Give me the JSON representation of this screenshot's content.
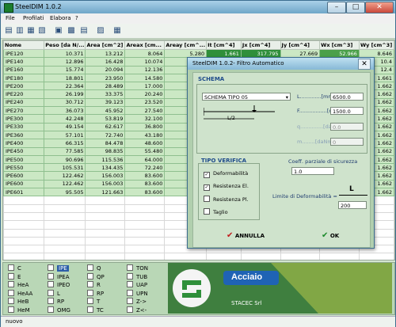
{
  "app": {
    "title": "SteelDIM 1.0.2"
  },
  "window_controls": {
    "minimize": "–",
    "maximize": "□",
    "close": "✕"
  },
  "menu": {
    "items": [
      "File",
      "Profilati",
      "Elabora",
      "?"
    ]
  },
  "toolbar": {
    "icons": [
      "new-icon",
      "open-icon",
      "save-icon",
      "print-icon",
      "table-icon",
      "grid-icon",
      "document-icon",
      "export-icon",
      "settings-icon"
    ]
  },
  "table": {
    "columns": [
      "Nome",
      "Peso [da N/...",
      "Area [cm^2]",
      "Areax [cm...",
      "Areay [cm^...",
      "It [cm^4]",
      "Jx [cm^4]",
      "Jy [cm^4]",
      "Wx [cm^3]",
      "Wy [cm^3]"
    ],
    "rows": [
      [
        "IPE120",
        "10.371",
        "13.212",
        "8.064",
        "5.280",
        "1.661",
        "317.795",
        "27.669",
        "52.966",
        "8.646"
      ],
      [
        "IPE140",
        "12.896",
        "16.428",
        "10.074",
        "6.",
        "",
        "",
        "",
        "",
        "10.4"
      ],
      [
        "IPE160",
        "15.774",
        "20.094",
        "12.136",
        "8.",
        "",
        "",
        "",
        "",
        "12.4"
      ],
      [
        "IPE180",
        "18.801",
        "23.950",
        "14.580",
        "9.",
        "",
        "",
        "",
        "",
        "1.661"
      ],
      [
        "IPE200",
        "22.364",
        "28.489",
        "17.000",
        "11.",
        "",
        "",
        "",
        "",
        "1.662"
      ],
      [
        "IPE220",
        "26.199",
        "33.375",
        "20.240",
        "12.",
        "",
        "",
        "",
        "",
        "1.662"
      ],
      [
        "IPE240",
        "30.712",
        "39.123",
        "23.520",
        "14.",
        "",
        "",
        "",
        "",
        "1.662"
      ],
      [
        "IPE270",
        "36.073",
        "45.952",
        "27.540",
        "17.",
        "",
        "",
        "",
        "",
        "1.662"
      ],
      [
        "IPE300",
        "42.248",
        "53.819",
        "32.100",
        "21.",
        "",
        "",
        "",
        "",
        "1.662"
      ],
      [
        "IPE330",
        "49.154",
        "62.617",
        "36.800",
        "24.",
        "",
        "",
        "",
        "",
        "1.662"
      ],
      [
        "IPE360",
        "57.101",
        "72.740",
        "43.180",
        "28.",
        "",
        "",
        "",
        "",
        "1.662"
      ],
      [
        "IPE400",
        "66.315",
        "84.478",
        "48.600",
        "34.",
        "",
        "",
        "",
        "",
        "1.662"
      ],
      [
        "IPE450",
        "77.585",
        "98.835",
        "55.480",
        "42.",
        "",
        "",
        "",
        "",
        "1.662"
      ],
      [
        "IPE500",
        "90.696",
        "115.536",
        "64.000",
        "51.",
        "",
        "",
        "",
        "",
        "1.662"
      ],
      [
        "IPE550",
        "105.531",
        "134.435",
        "72.240",
        "61.",
        "",
        "",
        "",
        "",
        "1.662"
      ],
      [
        "IPE600",
        "122.462",
        "156.003",
        "83.600",
        "72.",
        "",
        "",
        "",
        "",
        "1.662"
      ],
      [
        "IPE600",
        "122.462",
        "156.003",
        "83.600",
        "72.",
        "",
        "",
        "",
        "",
        "1.662"
      ],
      [
        "IPE601",
        "95.505",
        "121.663",
        "83.600",
        "52.",
        "",
        "",
        "",
        "",
        "1.662"
      ]
    ]
  },
  "profile_types": {
    "col1": [
      "C",
      "E",
      "HeA",
      "HeAA",
      "HeB",
      "HeM"
    ],
    "col2": [
      "IPE",
      "IPEA",
      "IPEO",
      "L",
      "RP",
      "OMG"
    ],
    "col3": [
      "Q",
      "QP",
      "R",
      "RP",
      "T",
      "TC"
    ],
    "col4": [
      "TON",
      "TUB",
      "UAP",
      "UPN",
      "Z->",
      "Z<-"
    ],
    "selected": "IPE"
  },
  "logo": {
    "product": "Acciaio",
    "company": "STACEC Srl"
  },
  "status": {
    "text": "nuovo"
  },
  "dialog": {
    "title": "SteelDIM 1.0.2- Filtro Automatico",
    "close": "✕",
    "schema": {
      "heading": "SCHEMA",
      "select_value": "SCHEMA TIPO 05",
      "L_label": "L.............[mm]",
      "L_value": "6500.0",
      "F_label": "F.................[daN]",
      "F_value": "1500.0",
      "q_label": "q..............[daN/m]",
      "q_value": "0.0",
      "m_label": "m........[daNm/m]",
      "m_value": "0",
      "dim_label": "L/2"
    },
    "verifica": {
      "heading": "TIPO VERIFICA",
      "items": [
        {
          "label": "Deformabilità",
          "checked": true
        },
        {
          "label": "Resistenza El.",
          "checked": true
        },
        {
          "label": "Resistenza Pl.",
          "checked": false
        },
        {
          "label": "Taglio",
          "checked": false
        }
      ]
    },
    "coeff_label": "Coeff. parziale di sicurezza",
    "coeff_value": "1.0",
    "deform_label": "Limite di Deformabilità =",
    "deform_numerator": "L",
    "deform_value": "200",
    "cancel_label": "ANNULLA",
    "ok_label": "OK"
  }
}
